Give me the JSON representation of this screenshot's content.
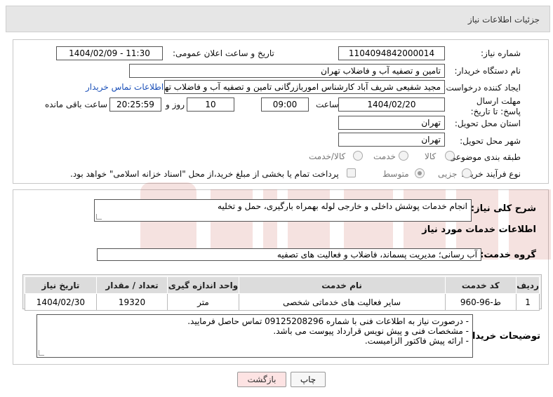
{
  "header": {
    "title": "جزئیات اطلاعات نیاز"
  },
  "form": {
    "need_number_label": "شماره نیاز:",
    "need_number": "1104094842000014",
    "announce_label": "تاریخ و ساعت اعلان عمومی:",
    "announce_value": "1404/02/09 - 11:30",
    "buyer_org_label": "نام دستگاه خریدار:",
    "buyer_org": "تامین و تصفیه آب و فاضلاب تهران",
    "requester_label": "ایجاد کننده درخواست:",
    "requester": "مجید شفیعی شریف آباد کارشناس اموربازرگانی تامین و تصفیه آب و فاضلاب تهران",
    "contact_link": "اطلاعات تماس خریدار",
    "deadline_label": "مهلت ارسال پاسخ: تا تاریخ:",
    "deadline_date": "1404/02/20",
    "time_label": "ساعت",
    "deadline_time": "09:00",
    "days_value": "10",
    "days_label": "روز و",
    "remaining_time": "20:25:59",
    "remaining_label": "ساعت باقی مانده",
    "province_label": "استان محل تحویل:",
    "province": "تهران",
    "city_label": "شهر محل تحویل:",
    "city": "تهران",
    "category_label": "طبقه بندی موضوعی:",
    "category_options": [
      "کالا",
      "خدمت",
      "کالا/خدمت"
    ],
    "category_selected": "خدمت",
    "process_label": "نوع فرآیند خرید :",
    "process_options": [
      "جزیی",
      "متوسط"
    ],
    "process_selected": "متوسط",
    "treasury_note": "پرداخت تمام یا بخشی از مبلغ خرید،از محل \"اسناد خزانه اسلامی\" خواهد بود."
  },
  "summary": {
    "label": "شرح کلی نیاز:",
    "text": "انجام خدمات پوشش داخلی و خارجی لوله بهمراه بارگیری، حمل و تخلیه"
  },
  "services": {
    "section_title": "اطلاعات خدمات مورد نیاز",
    "group_label": "گروه خدمت:",
    "group_value": "آب رسانی؛ مدیریت پسماند، فاضلاب و فعالیت های تصفیه",
    "columns": [
      "ردیف",
      "کد خدمت",
      "نام خدمت",
      "واحد اندازه گیری",
      "تعداد / مقدار",
      "تاریخ نیاز"
    ],
    "rows": [
      {
        "row": "1",
        "code": "ط-96-960",
        "name": "سایر فعالیت های خدماتی شخصی",
        "unit": "متر",
        "qty": "19320",
        "date": "1404/02/30"
      }
    ]
  },
  "buyer_notes": {
    "label": "توضیحات خریدار:",
    "lines": [
      "- درصورت نیاز به اطلاعات فنی با شماره 09125208296 تماس حاصل فرمایید.",
      "- مشخصات فنی و پیش نویس قرارداد پیوست می باشد.",
      "- ارائه پیش فاکتور الزامیست."
    ]
  },
  "buttons": {
    "print": "چاپ",
    "back": "بازگشت"
  },
  "colors": {
    "link": "#1a4fb8",
    "back_button_bg": "#fde3e3",
    "header_bg": "#e6e6e6",
    "table_header_bg": "#dcdcdc",
    "watermark": "#c0392b"
  }
}
